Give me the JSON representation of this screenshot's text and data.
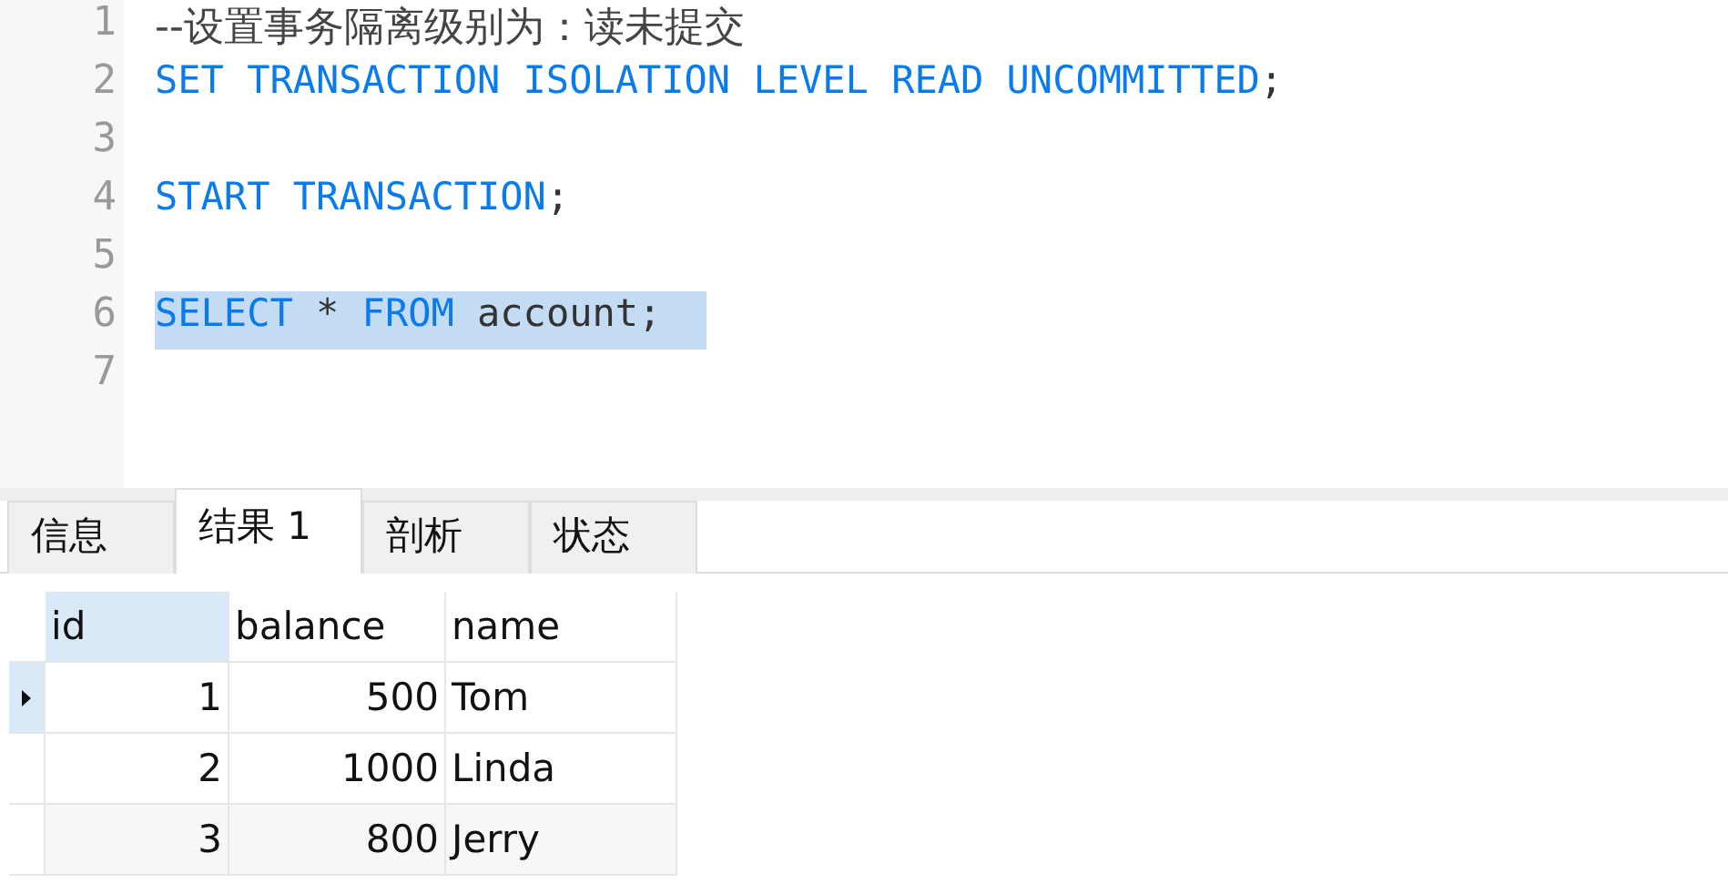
{
  "editor": {
    "lines": [
      {
        "number": "1",
        "selected": false,
        "tokens": [
          {
            "kind": "comment",
            "text": "--设置事务隔离级别为：读未提交"
          }
        ]
      },
      {
        "number": "2",
        "selected": false,
        "tokens": [
          {
            "kind": "keyword",
            "text": "SET TRANSACTION ISOLATION LEVEL READ UNCOMMITTED"
          },
          {
            "kind": "plain",
            "text": ";"
          }
        ]
      },
      {
        "number": "3",
        "selected": false
      },
      {
        "number": "4",
        "selected": false,
        "tokens": [
          {
            "kind": "keyword",
            "text": "START TRANSACTION"
          },
          {
            "kind": "plain",
            "text": ";"
          }
        ]
      },
      {
        "number": "5",
        "selected": false
      },
      {
        "number": "6",
        "selected": true,
        "tokens": [
          {
            "kind": "keyword",
            "text": "SELECT"
          },
          {
            "kind": "plain",
            "text": " * "
          },
          {
            "kind": "keyword",
            "text": "FROM"
          },
          {
            "kind": "plain",
            "text": " account;  "
          }
        ]
      },
      {
        "number": "7",
        "selected": false
      }
    ]
  },
  "tabs": [
    {
      "label": "信息",
      "selected": false
    },
    {
      "label": "结果 1",
      "selected": true
    },
    {
      "label": "剖析",
      "selected": false
    },
    {
      "label": "状态",
      "selected": false
    }
  ],
  "table": {
    "columns": [
      {
        "label": "id",
        "selected": true
      },
      {
        "label": "balance",
        "selected": false
      },
      {
        "label": "name",
        "selected": false
      }
    ],
    "rows": [
      {
        "selected": true,
        "cells": [
          "1",
          "500",
          "Tom"
        ]
      },
      {
        "selected": false,
        "cells": [
          "2",
          "1000",
          "Linda"
        ]
      },
      {
        "selected": false,
        "cells": [
          "3",
          "800",
          "Jerry"
        ]
      }
    ]
  }
}
